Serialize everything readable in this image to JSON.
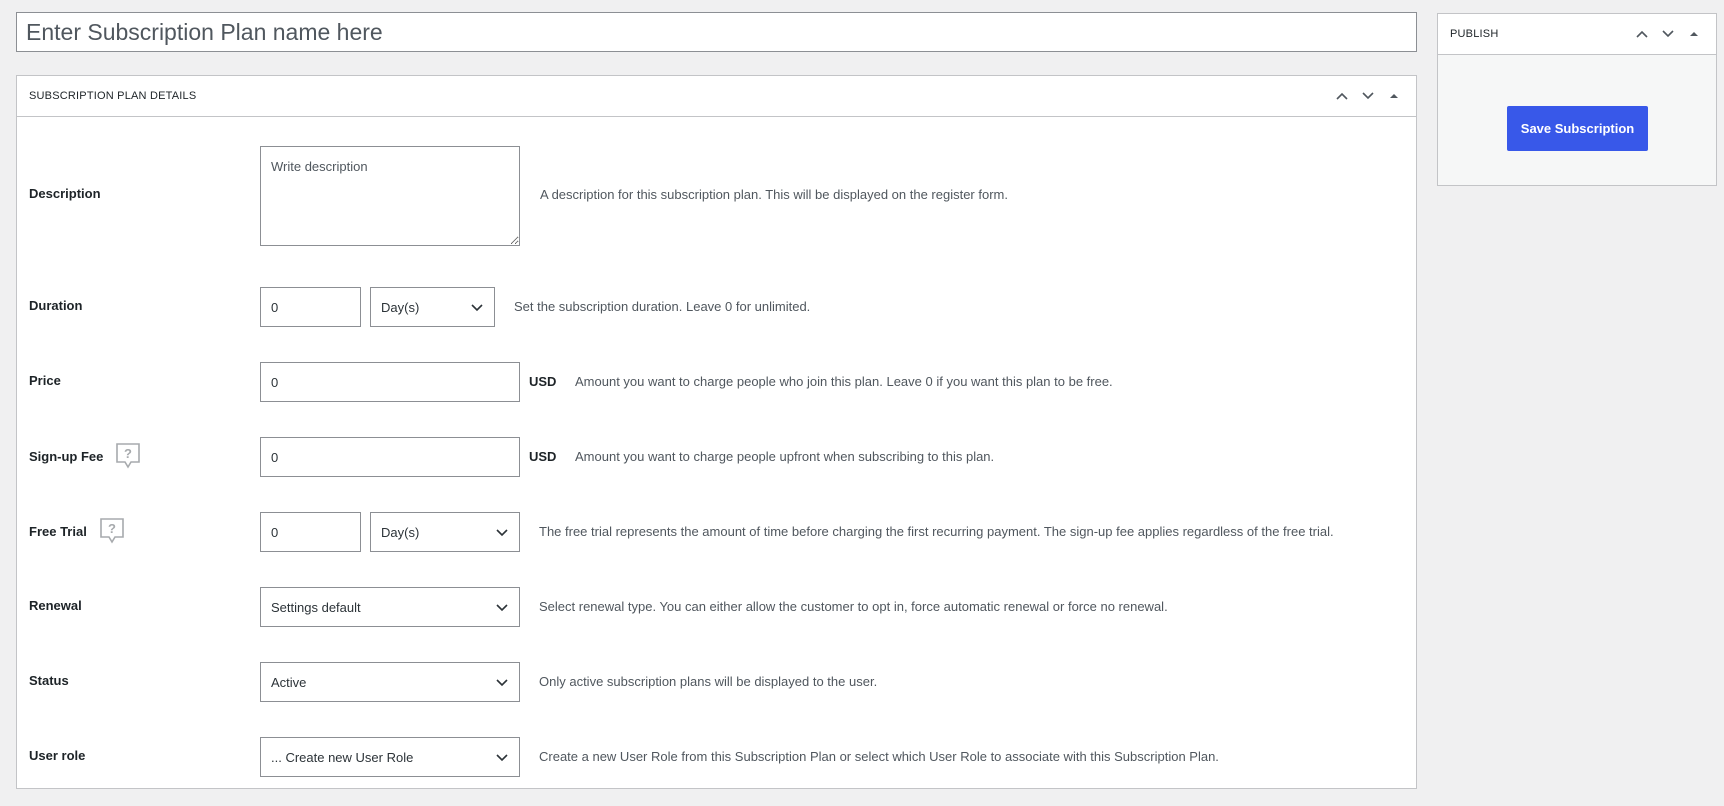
{
  "title_input": {
    "placeholder": "Enter Subscription Plan name here"
  },
  "details_box": {
    "title": "SUBSCRIPTION PLAN DETAILS",
    "fields": {
      "description": {
        "label": "Description",
        "placeholder": "Write description",
        "help": "A description for this subscription plan. This will be displayed on the register form."
      },
      "duration": {
        "label": "Duration",
        "value": "0",
        "unit": "Day(s)",
        "help": "Set the subscription duration. Leave 0 for unlimited."
      },
      "price": {
        "label": "Price",
        "value": "0",
        "currency": "USD",
        "help": "Amount you want to charge people who join this plan. Leave 0 if you want this plan to be free."
      },
      "signup_fee": {
        "label": "Sign-up Fee",
        "value": "0",
        "currency": "USD",
        "help": "Amount you want to charge people upfront when subscribing to this plan."
      },
      "free_trial": {
        "label": "Free Trial",
        "value": "0",
        "unit": "Day(s)",
        "help": "The free trial represents the amount of time before charging the first recurring payment. The sign-up fee applies regardless of the free trial."
      },
      "renewal": {
        "label": "Renewal",
        "value": "Settings default",
        "help": "Select renewal type. You can either allow the customer to opt in, force automatic renewal or force no renewal."
      },
      "status": {
        "label": "Status",
        "value": "Active",
        "help": "Only active subscription plans will be displayed to the user."
      },
      "user_role": {
        "label": "User role",
        "value": "... Create new User Role",
        "help": "Create a new User Role from this Subscription Plan or select which User Role to associate with this Subscription Plan."
      }
    }
  },
  "publish_box": {
    "title": "PUBLISH",
    "save_label": "Save Subscription"
  },
  "colors": {
    "background": "#f0f0f1",
    "accent": "#3858e9",
    "border": "#c3c4c7"
  }
}
